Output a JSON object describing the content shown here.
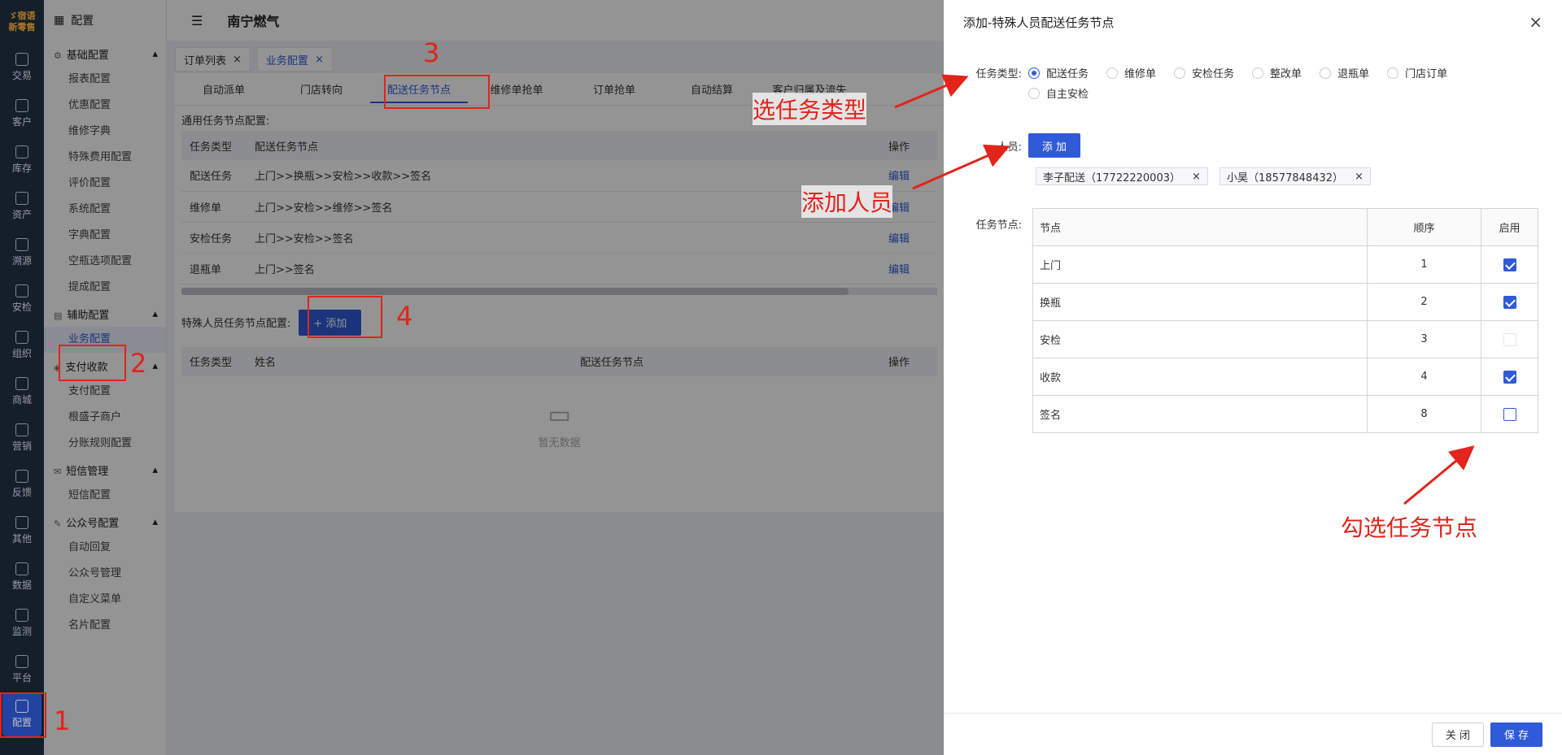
{
  "rail": {
    "logo_top": "ゞ宿语",
    "logo_bottom": "新零售",
    "items": [
      "交易",
      "客户",
      "库存",
      "资产",
      "溯源",
      "安检",
      "组织",
      "商城",
      "营销",
      "反馈",
      "其他",
      "数据",
      "监测",
      "平台"
    ],
    "active": "配置"
  },
  "submenu": {
    "title": "配置",
    "groups": [
      {
        "label": "基础配置",
        "items": [
          "报表配置",
          "优惠配置",
          "维修字典",
          "特殊费用配置",
          "评价配置",
          "系统配置",
          "字典配置",
          "空瓶选项配置",
          "提成配置"
        ]
      },
      {
        "label": "辅助配置",
        "items": [
          "业务配置"
        ]
      },
      {
        "label": "支付收款",
        "items": [
          "支付配置",
          "根盛子商户",
          "分账规则配置"
        ]
      },
      {
        "label": "短信管理",
        "items": [
          "短信配置"
        ]
      },
      {
        "label": "公众号配置",
        "items": [
          "自动回复",
          "公众号管理",
          "自定义菜单",
          "名片配置"
        ]
      }
    ]
  },
  "topbar": {
    "title": "南宁燃气"
  },
  "tabs": [
    {
      "label": "订单列表"
    },
    {
      "label": "业务配置"
    }
  ],
  "subtabs": [
    "自动派单",
    "门店转向",
    "配送任务节点",
    "维修单抢单",
    "订单抢单",
    "自动结算",
    "客户归属及流失"
  ],
  "general": {
    "label": "通用任务节点配置:",
    "headers": [
      "任务类型",
      "配送任务节点",
      "操作"
    ],
    "rows": [
      {
        "type": "配送任务",
        "nodes": "上门>>换瓶>>安检>>收款>>签名",
        "action": "编辑"
      },
      {
        "type": "维修单",
        "nodes": "上门>>安检>>维修>>签名",
        "action": "编辑"
      },
      {
        "type": "安检任务",
        "nodes": "上门>>安检>>签名",
        "action": "编辑"
      },
      {
        "type": "退瓶单",
        "nodes": "上门>>签名",
        "action": "编辑"
      }
    ]
  },
  "special": {
    "label": "特殊人员任务节点配置:",
    "add_label": "+ 添加",
    "headers": [
      "任务类型",
      "姓名",
      "配送任务节点",
      "操作"
    ],
    "empty": "暂无数据"
  },
  "drawer": {
    "title": "添加-特殊人员配送任务节点",
    "type_label": "任务类型:",
    "types": [
      "配送任务",
      "维修单",
      "安检任务",
      "整改单",
      "退瓶单",
      "门店订单",
      "自主安检"
    ],
    "person_label": "人员:",
    "add_person": "添 加",
    "persons": [
      "李子配送（17722220003）",
      "小昊（18577848432）"
    ],
    "node_label": "任务节点:",
    "node_headers": [
      "节点",
      "顺序",
      "启用"
    ],
    "nodes": [
      {
        "name": "上门",
        "order": "1",
        "enabled": true
      },
      {
        "name": "换瓶",
        "order": "2",
        "enabled": true
      },
      {
        "name": "安检",
        "order": "3",
        "enabled": false
      },
      {
        "name": "收款",
        "order": "4",
        "enabled": true
      },
      {
        "name": "签名",
        "order": "8",
        "enabled": false
      }
    ],
    "close": "关 闭",
    "save": "保 存"
  },
  "annotations": {
    "n1": "1",
    "n2": "2",
    "n3": "3",
    "n4": "4",
    "select_type": "选任务类型",
    "add_person": "添加人员",
    "check_nodes": "勾选任务节点"
  },
  "colors": {
    "accent": "#2f5ad8",
    "annotation": "#e2241b"
  }
}
